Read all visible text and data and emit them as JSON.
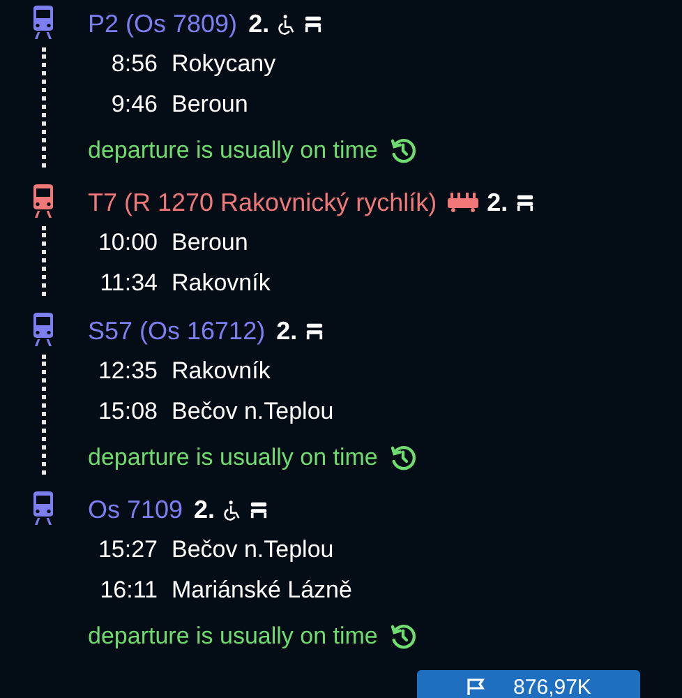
{
  "legs": [
    {
      "title": "P2 (Os 7809)",
      "color": "#7d7ff0",
      "features": [
        {
          "kind": "class",
          "text": "2."
        },
        {
          "kind": "wheelchair"
        },
        {
          "kind": "seat"
        }
      ],
      "stops": [
        {
          "time": "8:56",
          "station": "Rokycany"
        },
        {
          "time": "9:46",
          "station": "Beroun"
        }
      ],
      "note": "departure is usually on time"
    },
    {
      "title": "T7 (R 1270 Rakovnický rychlík)",
      "color": "#f07878",
      "features": [
        {
          "kind": "dining-car"
        },
        {
          "kind": "class",
          "text": "2."
        },
        {
          "kind": "seat"
        }
      ],
      "stops": [
        {
          "time": "10:00",
          "station": "Beroun"
        },
        {
          "time": "11:34",
          "station": "Rakovník"
        }
      ]
    },
    {
      "title": "S57 (Os 16712)",
      "color": "#7d7ff0",
      "features": [
        {
          "kind": "class",
          "text": "2."
        },
        {
          "kind": "seat"
        }
      ],
      "stops": [
        {
          "time": "12:35",
          "station": "Rakovník"
        },
        {
          "time": "15:08",
          "station": "Bečov n.Teplou"
        }
      ],
      "note": "departure is usually on time"
    },
    {
      "title": "Os 7109",
      "color": "#7d7ff0",
      "features": [
        {
          "kind": "class",
          "text": "2."
        },
        {
          "kind": "wheelchair"
        },
        {
          "kind": "seat"
        }
      ],
      "stops": [
        {
          "time": "15:27",
          "station": "Bečov n.Teplou"
        },
        {
          "time": "16:11",
          "station": "Mariánské Lázně"
        }
      ],
      "note": "departure is usually on time"
    }
  ],
  "download_button": {
    "label": "876,97K"
  }
}
